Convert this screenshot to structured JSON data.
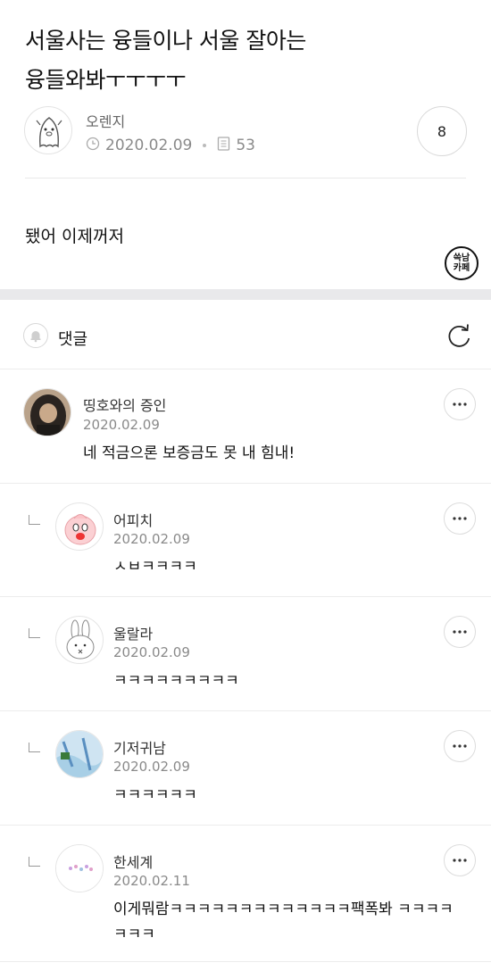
{
  "post": {
    "title": "서울사는 융들이나 서울 잘아는 융들와봐ㅜㅜㅜㅜ",
    "author": "오렌지",
    "date": "2020.02.09",
    "views": "53",
    "comment_count": "8",
    "body": "됐어 이제꺼저",
    "cafe_badge_line1": "쓱남",
    "cafe_badge_line2": "카페"
  },
  "comments_section": {
    "title": "댓글"
  },
  "comments": [
    {
      "author": "띵호와의 증인",
      "date": "2020.02.09",
      "text": "네 적금으론 보증금도 못 내 힘내!",
      "reply": false
    },
    {
      "author": "어피치",
      "date": "2020.02.09",
      "text": "ㅅㅂㅋㅋㅋㅋ",
      "reply": true
    },
    {
      "author": "울랄라",
      "date": "2020.02.09",
      "text": "ㅋㅋㅋㅋㅋㅋㅋㅋㅋ",
      "reply": true
    },
    {
      "author": "기저귀남",
      "date": "2020.02.09",
      "text": "ㅋㅋㅋㅋㅋㅋ",
      "reply": true
    },
    {
      "author": "한세계",
      "date": "2020.02.11",
      "text": "이게뭐람ㅋㅋㅋㅋㅋㅋㅋㅋㅋㅋㅋㅋㅋ팩폭봐 ㅋㅋㅋㅋㅋㅋㅋ",
      "reply": true
    }
  ],
  "colors": {
    "section_band": "#e9e9eb",
    "meta_gray": "#8a8a8a",
    "divider": "#ececec"
  }
}
